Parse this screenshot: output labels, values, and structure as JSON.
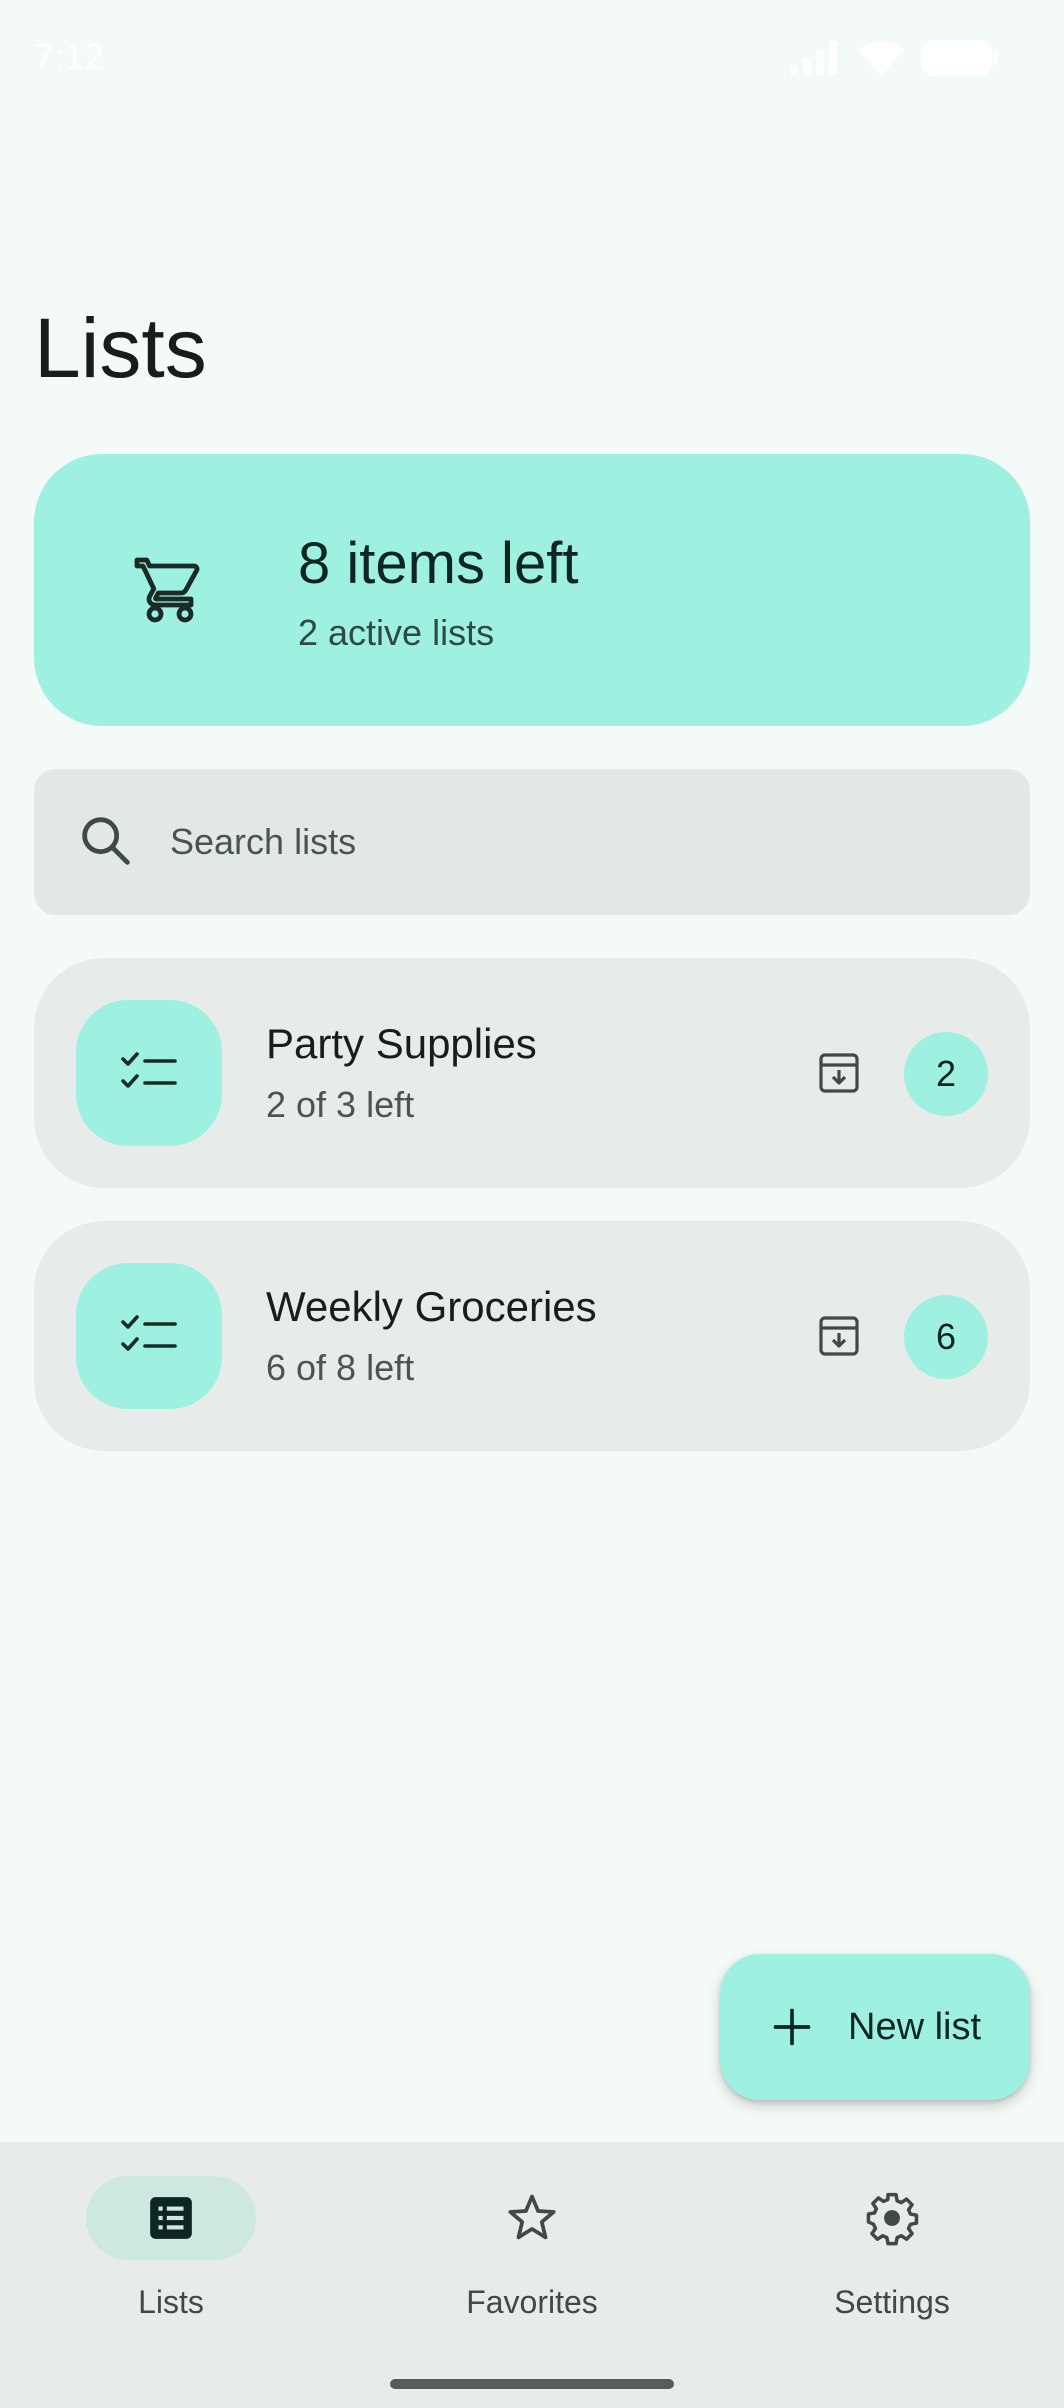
{
  "status_bar": {
    "time": "7:12"
  },
  "header": {
    "title": "Lists"
  },
  "summary": {
    "title": "8 items left",
    "subtitle": "2 active lists",
    "icon": "shopping-cart-icon"
  },
  "search": {
    "placeholder": "Search lists",
    "value": ""
  },
  "lists": [
    {
      "name": "Party Supplies",
      "meta": "2 of 3 left",
      "count": "2"
    },
    {
      "name": "Weekly Groceries",
      "meta": "6 of 8 left",
      "count": "6"
    }
  ],
  "fab": {
    "label": "New list"
  },
  "nav": {
    "items": [
      {
        "label": "Lists",
        "icon": "list-icon",
        "active": true
      },
      {
        "label": "Favorites",
        "icon": "star-icon",
        "active": false
      },
      {
        "label": "Settings",
        "icon": "gear-icon",
        "active": false
      }
    ]
  },
  "colors": {
    "background": "#f4faf8",
    "accent": "#9ef0e1",
    "surface": "#e7ecea",
    "nav_active": "#cce8e1"
  }
}
